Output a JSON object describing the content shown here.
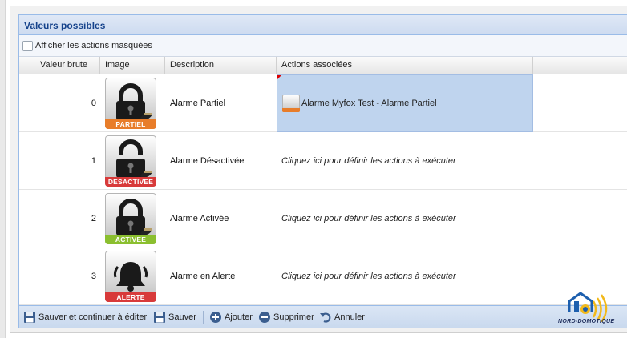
{
  "panel": {
    "title": "Valeurs possibles"
  },
  "filter": {
    "label": "Afficher les actions masquées",
    "checked": false
  },
  "columns": [
    "Valeur brute",
    "Image",
    "Description",
    "Actions associées"
  ],
  "rows": [
    {
      "value": "0",
      "icon": "lock-closed-icon",
      "tag": "PARTIEL",
      "tag_color": "#e87d2a",
      "description": "Alarme Partiel",
      "action": "Alarme Myfox Test - Alarme Partiel",
      "selected": true
    },
    {
      "value": "1",
      "icon": "lock-open-icon",
      "tag": "DESACTIVEE",
      "tag_color": "#d83a3a",
      "description": "Alarme Désactivée",
      "action": "Cliquez ici pour définir les actions à exécuter",
      "selected": false
    },
    {
      "value": "2",
      "icon": "lock-closed-icon",
      "tag": "ACTIVEE",
      "tag_color": "#8bbf2f",
      "description": "Alarme Activée",
      "action": "Cliquez ici pour définir les actions à exécuter",
      "selected": false
    },
    {
      "value": "3",
      "icon": "bell-icon",
      "tag": "ALERTE",
      "tag_color": "#d83a3a",
      "description": "Alarme en Alerte",
      "action": "Cliquez ici pour définir les actions à exécuter",
      "selected": false
    }
  ],
  "toolbar": {
    "save_continue": "Sauver et continuer à éditer",
    "save": "Sauver",
    "add": "Ajouter",
    "delete": "Supprimer",
    "cancel": "Annuler"
  },
  "watermark": {
    "text": "NORD-DOMOTIQUE"
  }
}
